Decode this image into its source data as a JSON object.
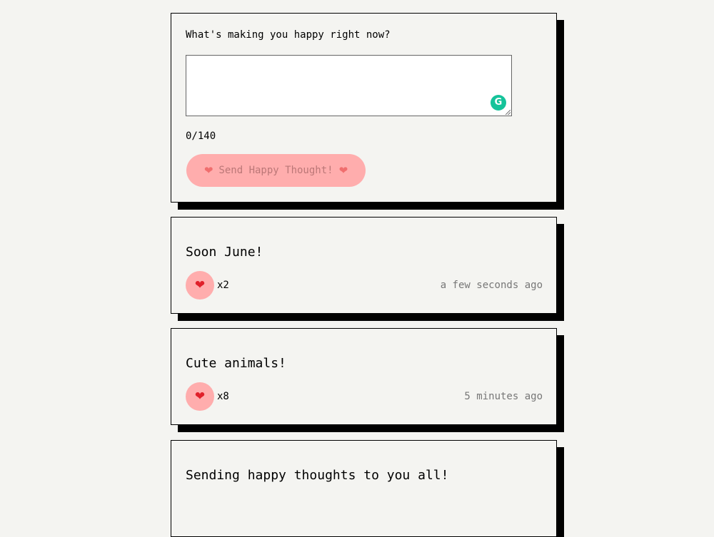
{
  "form": {
    "prompt": "What's making you happy right now?",
    "input_value": "",
    "counter": "0/140",
    "send_label": "Send Happy Thought!",
    "heart": "❤"
  },
  "thoughts": [
    {
      "message": "Soon June!",
      "likes": "x2",
      "time": "a few seconds ago"
    },
    {
      "message": "Cute animals!",
      "likes": "x8",
      "time": "5 minutes ago"
    },
    {
      "message": "Sending happy thoughts to you all!",
      "likes": "",
      "time": ""
    }
  ],
  "icons": {
    "grammarly": "G",
    "like": "❤"
  },
  "colors": {
    "background": "#f4f4f1",
    "button_pink": "#ffadad",
    "heart_red": "#e0202a",
    "grammarly_green": "#15c39a"
  }
}
